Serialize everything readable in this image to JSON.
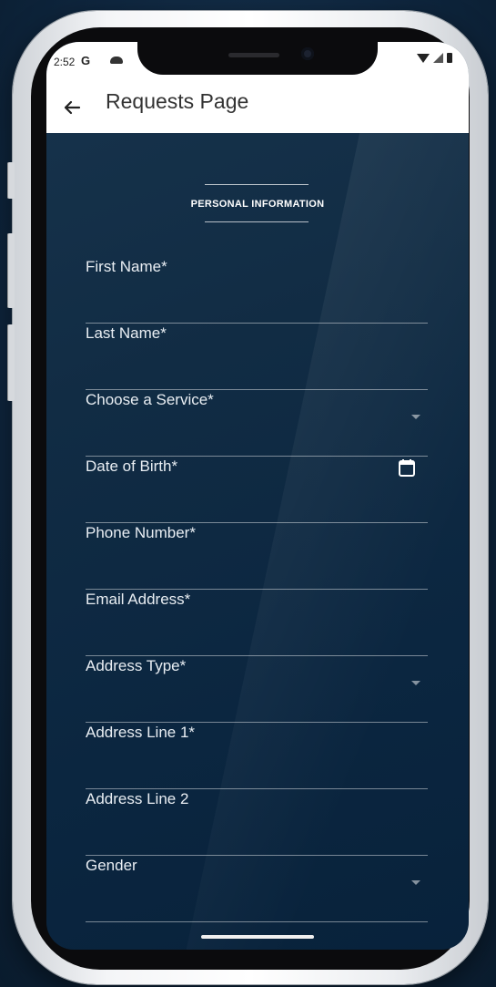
{
  "status_bar": {
    "time": "2:52",
    "g_label": "G"
  },
  "app_bar": {
    "title": "Requests Page"
  },
  "section": {
    "title": "PERSONAL INFORMATION"
  },
  "fields": [
    {
      "label": "First Name*",
      "kind": "text"
    },
    {
      "label": "Last Name*",
      "kind": "text"
    },
    {
      "label": "Choose a Service*",
      "kind": "dropdown"
    },
    {
      "label": "Date of Birth*",
      "kind": "date"
    },
    {
      "label": "Phone Number*",
      "kind": "text"
    },
    {
      "label": "Email Address*",
      "kind": "text"
    },
    {
      "label": "Address Type*",
      "kind": "dropdown"
    },
    {
      "label": "Address Line 1*",
      "kind": "text"
    },
    {
      "label": "Address Line 2",
      "kind": "text"
    },
    {
      "label": "Gender",
      "kind": "dropdown"
    }
  ],
  "colors": {
    "background": "#0f2740",
    "screen": "#112c44",
    "appbar": "#ffffff"
  }
}
